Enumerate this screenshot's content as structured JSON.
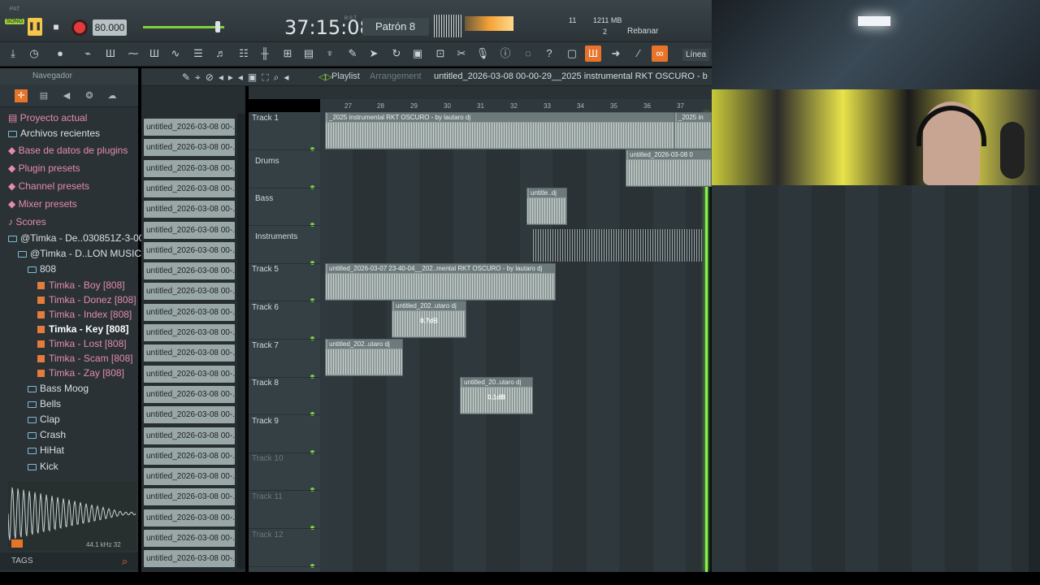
{
  "transport": {
    "mode_pat": "PAT",
    "mode_song": "SONG",
    "tempo": "80.000",
    "time": "37:15:08",
    "time_label": "B:S:T",
    "pattern": "Patrón 8",
    "cpu_value": "11",
    "memory": "1211 MB",
    "polyphony": "2",
    "snap_label": "Rebanar",
    "line_label": "Línea"
  },
  "browser": {
    "header": "Navegador",
    "items": [
      {
        "label": "Proyecto actual",
        "style": "pink",
        "indent": 0,
        "icon": "project-icon"
      },
      {
        "label": "Archivos recientes",
        "style": "light",
        "indent": 0,
        "icon": "folder-icon"
      },
      {
        "label": "Base de datos de plugins",
        "style": "pink",
        "indent": 0,
        "icon": "plugin-icon"
      },
      {
        "label": "Plugin presets",
        "style": "pink",
        "indent": 0,
        "icon": "plugin-icon"
      },
      {
        "label": "Channel presets",
        "style": "pink",
        "indent": 0,
        "icon": "plugin-icon"
      },
      {
        "label": "Mixer presets",
        "style": "pink",
        "indent": 0,
        "icon": "plugin-icon"
      },
      {
        "label": "Scores",
        "style": "pink",
        "indent": 0,
        "icon": "note-icon"
      },
      {
        "label": "@Timka - De..030851Z-3-001",
        "style": "light",
        "indent": 0,
        "icon": "folder-icon"
      },
      {
        "label": "@Timka - D..LON MUSIC_",
        "style": "light",
        "indent": 1,
        "icon": "folder-icon"
      },
      {
        "label": "808",
        "style": "light",
        "indent": 2,
        "icon": "folder-icon"
      },
      {
        "label": "Timka - Boy [808]",
        "style": "pink",
        "indent": 3,
        "icon": "audio-file-icon"
      },
      {
        "label": "Timka - Donez [808]",
        "style": "pink",
        "indent": 3,
        "icon": "audio-file-icon"
      },
      {
        "label": "Timka - Index [808]",
        "style": "pink",
        "indent": 3,
        "icon": "audio-file-icon"
      },
      {
        "label": "Timka - Key [808]",
        "style": "sel",
        "indent": 3,
        "icon": "audio-file-icon"
      },
      {
        "label": "Timka - Lost [808]",
        "style": "pink",
        "indent": 3,
        "icon": "audio-file-icon"
      },
      {
        "label": "Timka - Scam [808]",
        "style": "pink",
        "indent": 3,
        "icon": "audio-file-icon"
      },
      {
        "label": "Timka - Zay [808]",
        "style": "pink",
        "indent": 3,
        "icon": "audio-file-icon"
      },
      {
        "label": "Bass Moog",
        "style": "light",
        "indent": 2,
        "icon": "folder-icon"
      },
      {
        "label": "Bells",
        "style": "light",
        "indent": 2,
        "icon": "folder-icon"
      },
      {
        "label": "Clap",
        "style": "light",
        "indent": 2,
        "icon": "folder-icon"
      },
      {
        "label": "Crash",
        "style": "light",
        "indent": 2,
        "icon": "folder-icon"
      },
      {
        "label": "HiHat",
        "style": "light",
        "indent": 2,
        "icon": "folder-icon"
      },
      {
        "label": "Kick",
        "style": "light",
        "indent": 2,
        "icon": "folder-icon"
      }
    ],
    "sample_info": "44.1 kHz 32",
    "tags": "TAGS"
  },
  "patterns": {
    "items": [
      "untitled_2026-03-08 00-...",
      "untitled_2026-03-08 00-...",
      "untitled_2026-03-08 00-...",
      "untitled_2026-03-08 00-...",
      "untitled_2026-03-08 00-...",
      "untitled_2026-03-08 00-...",
      "untitled_2026-03-08 00-...",
      "untitled_2026-03-08 00-...",
      "untitled_2026-03-08 00-...",
      "untitled_2026-03-08 00-...",
      "untitled_2026-03-08 00-...",
      "untitled_2026-03-08 00-...",
      "untitled_2026-03-08 00-...",
      "untitled_2026-03-08 00-...",
      "untitled_2026-03-08 00-...",
      "untitled_2026-03-08 00-...",
      "untitled_2026-03-08 00-...",
      "untitled_2026-03-08 00-...",
      "untitled_2026-03-08 00-...",
      "untitled_2026-03-08 00-...",
      "untitled_2026-03-08 00-...",
      "untitled_2026-03-08 00-..."
    ]
  },
  "playlist": {
    "title": "Playlist",
    "subtitle": "Arrangement",
    "file": "untitled_2026-03-08 00-00-29__2025 instrumental RKT OSCURO - b",
    "ruler": [
      "27",
      "28",
      "29",
      "30",
      "31",
      "32",
      "33",
      "34",
      "35",
      "36",
      "37"
    ],
    "tracks": [
      {
        "name": "Track 1",
        "dim": false
      },
      {
        "name": "Drums",
        "dim": false
      },
      {
        "name": "Bass",
        "dim": false
      },
      {
        "name": "Instruments",
        "dim": false
      },
      {
        "name": "Track 5",
        "dim": false
      },
      {
        "name": "Track 6",
        "dim": false
      },
      {
        "name": "Track 7",
        "dim": false
      },
      {
        "name": "Track 8",
        "dim": false
      },
      {
        "name": "Track 9",
        "dim": false
      },
      {
        "name": "Track 10",
        "dim": true
      },
      {
        "name": "Track 11",
        "dim": true
      },
      {
        "name": "Track 12",
        "dim": true
      }
    ],
    "clips": [
      {
        "label": "_2025 instrumental RKT OSCURO - by lautaro dj",
        "gain": ""
      },
      {
        "label": "_2025 in",
        "gain": ""
      },
      {
        "label": "untitled_2026-03-08 0",
        "gain": ""
      },
      {
        "label": "untitle..dj",
        "gain": ""
      },
      {
        "label": "untitled_2026-03-07 23-40-04__202..mental RKT OSCURO - by lautaro dj",
        "gain": ""
      },
      {
        "label": "untitled_202..utaro dj",
        "gain": "0.7dB"
      },
      {
        "label": "untitled_202..utaro dj",
        "gain": ""
      },
      {
        "label": "untitled_20..utaro dj",
        "gain": "0.1dB"
      }
    ]
  }
}
